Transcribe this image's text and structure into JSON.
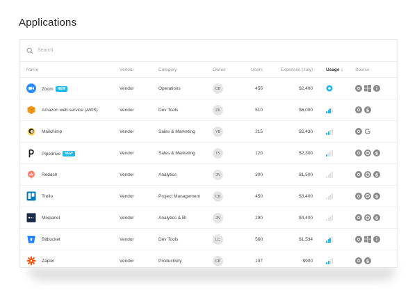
{
  "page": {
    "title": "Applications"
  },
  "search": {
    "placeholder": "Search"
  },
  "columns": {
    "name": "Name",
    "vendor": "Vendor",
    "category": "Category",
    "owner": "Owner",
    "users": "Users",
    "expenses": "Expenses (July)",
    "usage": "Usage ↓",
    "source": "Source"
  },
  "apps": [
    {
      "name": "Zoom",
      "badge": "NEW",
      "vendor": "Vendor",
      "category": "Operations",
      "owner": "CB",
      "users": "456",
      "expenses": "$2,400",
      "usage_level": 1,
      "usage_style": "circle",
      "logo_icon": "zoom-logo-icon",
      "logo_color": "#2d8cff",
      "sources": [
        "chrome-icon",
        "windows-icon",
        "info-icon"
      ]
    },
    {
      "name": "Amazon web service (AWS)",
      "badge": "",
      "vendor": "Vendor",
      "category": "Dev Tools",
      "owner": "ZK",
      "users": "510",
      "expenses": "$6,000",
      "usage_level": 0.75,
      "usage_style": "bars",
      "logo_icon": "aws-logo-icon",
      "logo_color": "#f49a1a",
      "sources": [
        "chrome-icon",
        "dollar-icon"
      ]
    },
    {
      "name": "Mailchimp",
      "badge": "",
      "vendor": "Vendor",
      "category": "Sales & Marketing",
      "owner": "YB",
      "users": "215",
      "expenses": "$2,430",
      "usage_level": 0.5,
      "usage_style": "bars",
      "logo_icon": "mailchimp-logo-icon",
      "logo_color": "#241c15",
      "sources": [
        "chrome-icon",
        "google-icon"
      ]
    },
    {
      "name": "Pipedrive",
      "badge": "NEW",
      "vendor": "Vendor",
      "category": "Sales & Marketing",
      "owner": "TS",
      "users": "120",
      "expenses": "$2,300",
      "usage_level": 0.25,
      "usage_style": "bars",
      "logo_icon": "pipedrive-logo-icon",
      "logo_color": "#1a1a1a",
      "sources": [
        "chrome-icon",
        "okta-icon",
        "dollar-icon"
      ]
    },
    {
      "name": "Redash",
      "badge": "",
      "vendor": "Vendor",
      "category": "Analytics",
      "owner": "JN",
      "users": "300",
      "expenses": "$1,500",
      "usage_level": 0,
      "usage_style": "bars",
      "logo_icon": "redash-logo-icon",
      "logo_color": "#ff7964",
      "sources": [
        "chrome-icon",
        "okta-icon",
        "dollar-icon"
      ]
    },
    {
      "name": "Trello",
      "badge": "",
      "vendor": "Vendor",
      "category": "Project Management",
      "owner": "CB",
      "users": "450",
      "expenses": "$3,400",
      "usage_level": 0,
      "usage_style": "bars",
      "logo_icon": "trello-logo-icon",
      "logo_color": "#0079bf",
      "sources": [
        "chrome-icon",
        "okta-icon",
        "dollar-icon"
      ]
    },
    {
      "name": "Mixpanel",
      "badge": "",
      "vendor": "Vendor",
      "category": "Analytics & BI",
      "owner": "JN",
      "users": "290",
      "expenses": "$4,400",
      "usage_level": 0,
      "usage_style": "bars",
      "logo_icon": "mixpanel-logo-icon",
      "logo_color": "#1c2a4a",
      "sources": [
        "chrome-icon",
        "okta-icon",
        "dollar-icon"
      ]
    },
    {
      "name": "Bitbucket",
      "badge": "",
      "vendor": "Vendor",
      "category": "Dev Tools",
      "owner": "LC",
      "users": "560",
      "expenses": "$1,534",
      "usage_level": 0.75,
      "usage_style": "bars",
      "logo_icon": "bitbucket-logo-icon",
      "logo_color": "#2684ff",
      "sources": [
        "chrome-icon",
        "windows-icon",
        "info-icon"
      ]
    },
    {
      "name": "Zapier",
      "badge": "",
      "vendor": "Vendor",
      "category": "Productivity",
      "owner": "CB",
      "users": "137",
      "expenses": "$900",
      "usage_level": 0.5,
      "usage_style": "bars",
      "logo_icon": "zapier-logo-icon",
      "logo_color": "#ff4a00",
      "sources": [
        "chrome-icon",
        "dollar-icon"
      ]
    }
  ],
  "colors": {
    "accent": "#1fb6e9",
    "muted": "#e3e3e3",
    "source_icon": "#8a8a8a"
  }
}
